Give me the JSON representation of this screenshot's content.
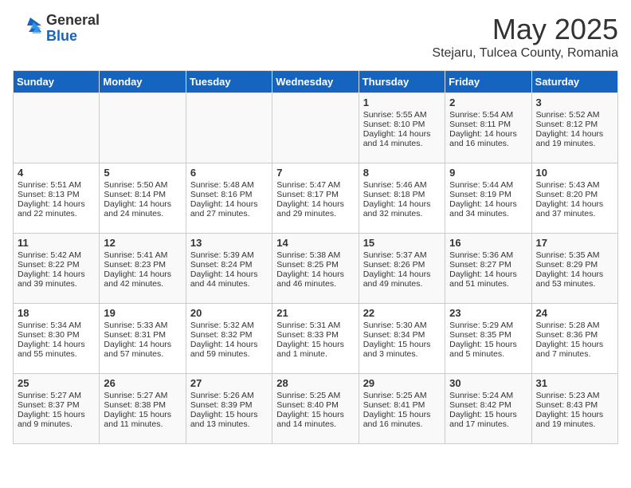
{
  "logo": {
    "general": "General",
    "blue": "Blue"
  },
  "title": "May 2025",
  "subtitle": "Stejaru, Tulcea County, Romania",
  "headers": [
    "Sunday",
    "Monday",
    "Tuesday",
    "Wednesday",
    "Thursday",
    "Friday",
    "Saturday"
  ],
  "weeks": [
    [
      {
        "day": "",
        "sunrise": "",
        "sunset": "",
        "daylight": ""
      },
      {
        "day": "",
        "sunrise": "",
        "sunset": "",
        "daylight": ""
      },
      {
        "day": "",
        "sunrise": "",
        "sunset": "",
        "daylight": ""
      },
      {
        "day": "",
        "sunrise": "",
        "sunset": "",
        "daylight": ""
      },
      {
        "day": "1",
        "sunrise": "Sunrise: 5:55 AM",
        "sunset": "Sunset: 8:10 PM",
        "daylight": "Daylight: 14 hours and 14 minutes."
      },
      {
        "day": "2",
        "sunrise": "Sunrise: 5:54 AM",
        "sunset": "Sunset: 8:11 PM",
        "daylight": "Daylight: 14 hours and 16 minutes."
      },
      {
        "day": "3",
        "sunrise": "Sunrise: 5:52 AM",
        "sunset": "Sunset: 8:12 PM",
        "daylight": "Daylight: 14 hours and 19 minutes."
      }
    ],
    [
      {
        "day": "4",
        "sunrise": "Sunrise: 5:51 AM",
        "sunset": "Sunset: 8:13 PM",
        "daylight": "Daylight: 14 hours and 22 minutes."
      },
      {
        "day": "5",
        "sunrise": "Sunrise: 5:50 AM",
        "sunset": "Sunset: 8:14 PM",
        "daylight": "Daylight: 14 hours and 24 minutes."
      },
      {
        "day": "6",
        "sunrise": "Sunrise: 5:48 AM",
        "sunset": "Sunset: 8:16 PM",
        "daylight": "Daylight: 14 hours and 27 minutes."
      },
      {
        "day": "7",
        "sunrise": "Sunrise: 5:47 AM",
        "sunset": "Sunset: 8:17 PM",
        "daylight": "Daylight: 14 hours and 29 minutes."
      },
      {
        "day": "8",
        "sunrise": "Sunrise: 5:46 AM",
        "sunset": "Sunset: 8:18 PM",
        "daylight": "Daylight: 14 hours and 32 minutes."
      },
      {
        "day": "9",
        "sunrise": "Sunrise: 5:44 AM",
        "sunset": "Sunset: 8:19 PM",
        "daylight": "Daylight: 14 hours and 34 minutes."
      },
      {
        "day": "10",
        "sunrise": "Sunrise: 5:43 AM",
        "sunset": "Sunset: 8:20 PM",
        "daylight": "Daylight: 14 hours and 37 minutes."
      }
    ],
    [
      {
        "day": "11",
        "sunrise": "Sunrise: 5:42 AM",
        "sunset": "Sunset: 8:22 PM",
        "daylight": "Daylight: 14 hours and 39 minutes."
      },
      {
        "day": "12",
        "sunrise": "Sunrise: 5:41 AM",
        "sunset": "Sunset: 8:23 PM",
        "daylight": "Daylight: 14 hours and 42 minutes."
      },
      {
        "day": "13",
        "sunrise": "Sunrise: 5:39 AM",
        "sunset": "Sunset: 8:24 PM",
        "daylight": "Daylight: 14 hours and 44 minutes."
      },
      {
        "day": "14",
        "sunrise": "Sunrise: 5:38 AM",
        "sunset": "Sunset: 8:25 PM",
        "daylight": "Daylight: 14 hours and 46 minutes."
      },
      {
        "day": "15",
        "sunrise": "Sunrise: 5:37 AM",
        "sunset": "Sunset: 8:26 PM",
        "daylight": "Daylight: 14 hours and 49 minutes."
      },
      {
        "day": "16",
        "sunrise": "Sunrise: 5:36 AM",
        "sunset": "Sunset: 8:27 PM",
        "daylight": "Daylight: 14 hours and 51 minutes."
      },
      {
        "day": "17",
        "sunrise": "Sunrise: 5:35 AM",
        "sunset": "Sunset: 8:29 PM",
        "daylight": "Daylight: 14 hours and 53 minutes."
      }
    ],
    [
      {
        "day": "18",
        "sunrise": "Sunrise: 5:34 AM",
        "sunset": "Sunset: 8:30 PM",
        "daylight": "Daylight: 14 hours and 55 minutes."
      },
      {
        "day": "19",
        "sunrise": "Sunrise: 5:33 AM",
        "sunset": "Sunset: 8:31 PM",
        "daylight": "Daylight: 14 hours and 57 minutes."
      },
      {
        "day": "20",
        "sunrise": "Sunrise: 5:32 AM",
        "sunset": "Sunset: 8:32 PM",
        "daylight": "Daylight: 14 hours and 59 minutes."
      },
      {
        "day": "21",
        "sunrise": "Sunrise: 5:31 AM",
        "sunset": "Sunset: 8:33 PM",
        "daylight": "Daylight: 15 hours and 1 minute."
      },
      {
        "day": "22",
        "sunrise": "Sunrise: 5:30 AM",
        "sunset": "Sunset: 8:34 PM",
        "daylight": "Daylight: 15 hours and 3 minutes."
      },
      {
        "day": "23",
        "sunrise": "Sunrise: 5:29 AM",
        "sunset": "Sunset: 8:35 PM",
        "daylight": "Daylight: 15 hours and 5 minutes."
      },
      {
        "day": "24",
        "sunrise": "Sunrise: 5:28 AM",
        "sunset": "Sunset: 8:36 PM",
        "daylight": "Daylight: 15 hours and 7 minutes."
      }
    ],
    [
      {
        "day": "25",
        "sunrise": "Sunrise: 5:27 AM",
        "sunset": "Sunset: 8:37 PM",
        "daylight": "Daylight: 15 hours and 9 minutes."
      },
      {
        "day": "26",
        "sunrise": "Sunrise: 5:27 AM",
        "sunset": "Sunset: 8:38 PM",
        "daylight": "Daylight: 15 hours and 11 minutes."
      },
      {
        "day": "27",
        "sunrise": "Sunrise: 5:26 AM",
        "sunset": "Sunset: 8:39 PM",
        "daylight": "Daylight: 15 hours and 13 minutes."
      },
      {
        "day": "28",
        "sunrise": "Sunrise: 5:25 AM",
        "sunset": "Sunset: 8:40 PM",
        "daylight": "Daylight: 15 hours and 14 minutes."
      },
      {
        "day": "29",
        "sunrise": "Sunrise: 5:25 AM",
        "sunset": "Sunset: 8:41 PM",
        "daylight": "Daylight: 15 hours and 16 minutes."
      },
      {
        "day": "30",
        "sunrise": "Sunrise: 5:24 AM",
        "sunset": "Sunset: 8:42 PM",
        "daylight": "Daylight: 15 hours and 17 minutes."
      },
      {
        "day": "31",
        "sunrise": "Sunrise: 5:23 AM",
        "sunset": "Sunset: 8:43 PM",
        "daylight": "Daylight: 15 hours and 19 minutes."
      }
    ]
  ]
}
